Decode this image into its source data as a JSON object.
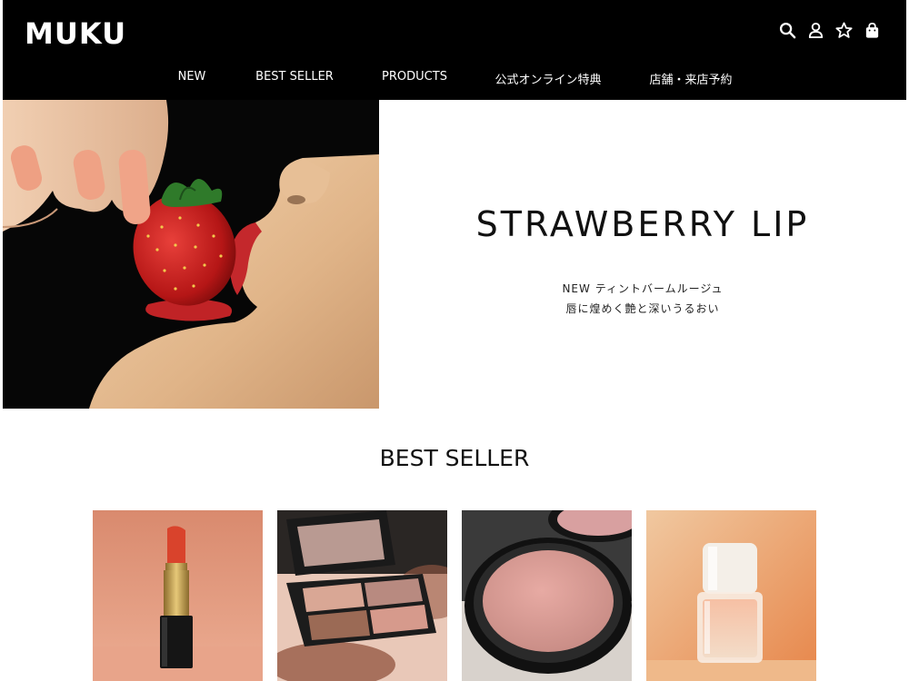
{
  "brand": {
    "logo": "MUKU"
  },
  "header": {
    "icons": [
      "search-icon",
      "user-icon",
      "star-icon",
      "shopping-bag-icon"
    ]
  },
  "nav": {
    "items": [
      {
        "label": "NEW"
      },
      {
        "label": "BEST SELLER"
      },
      {
        "label": "PRODUCTS"
      },
      {
        "label": "公式オンライン特典"
      },
      {
        "label": "店舗・来店予約"
      }
    ]
  },
  "hero": {
    "title": "STRAWBERRY LIP",
    "subtitle_line1": "NEW ティントバームルージュ",
    "subtitle_line2": "唇に煌めく艶と深いうるおい"
  },
  "best_seller": {
    "title": "BEST SELLER",
    "products": [
      {
        "image": "lipstick"
      },
      {
        "image": "eyeshadow-palette"
      },
      {
        "image": "blush-compact"
      },
      {
        "image": "nail-polish"
      }
    ]
  },
  "colors": {
    "header_bg": "#000000",
    "text": "#111111"
  }
}
